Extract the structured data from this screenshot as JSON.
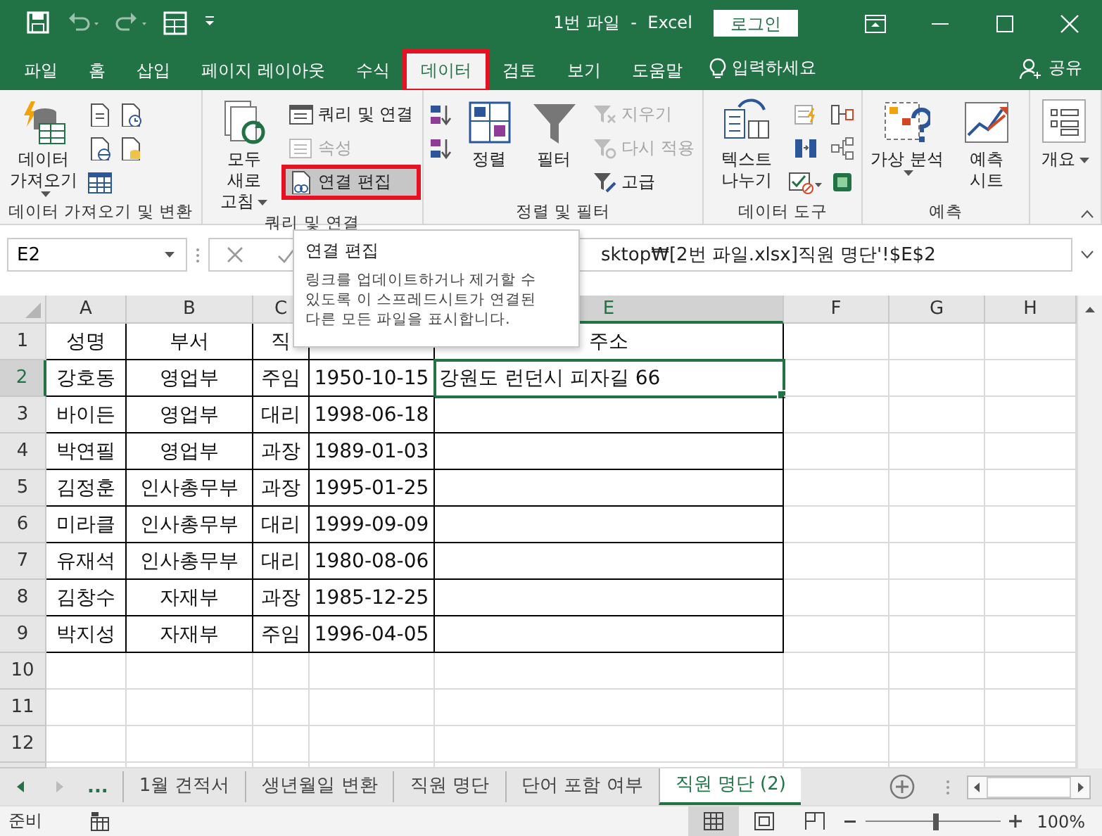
{
  "title_bar": {
    "title": "1번 파일  -  Excel",
    "login_button": "로그인",
    "quick_access": [
      {
        "kind": "save",
        "disabled": false
      },
      {
        "kind": "undo",
        "disabled": true
      },
      {
        "kind": "redo",
        "disabled": true
      },
      {
        "kind": "form",
        "disabled": false
      },
      {
        "kind": "customize",
        "disabled": false
      }
    ]
  },
  "tabs": [
    {
      "label": "파일",
      "selected": false,
      "highlighted": false
    },
    {
      "label": "홈",
      "selected": false,
      "highlighted": false
    },
    {
      "label": "삽입",
      "selected": false,
      "highlighted": false
    },
    {
      "label": "페이지 레이아웃",
      "selected": false,
      "highlighted": false
    },
    {
      "label": "수식",
      "selected": false,
      "highlighted": false
    },
    {
      "label": "데이터",
      "selected": true,
      "highlighted": true
    },
    {
      "label": "검토",
      "selected": false,
      "highlighted": false
    },
    {
      "label": "보기",
      "selected": false,
      "highlighted": false
    },
    {
      "label": "도움말",
      "selected": false,
      "highlighted": false
    }
  ],
  "tell_me": "입력하세요",
  "share": "공유",
  "ribbon": {
    "groups": [
      {
        "label": "데이터 가져오기 및 변환",
        "items": [
          {
            "kind": "large",
            "label": "데이터 가져오기",
            "dropdown": true
          },
          {
            "kind": "icon"
          },
          {
            "kind": "icon"
          },
          {
            "kind": "icon"
          },
          {
            "kind": "icon"
          },
          {
            "kind": "icon"
          }
        ]
      },
      {
        "label": "쿼리 및 연결",
        "items": [
          {
            "kind": "large",
            "label": "모두 새로 고침",
            "dropdown": true
          },
          {
            "kind": "small",
            "label": "쿼리 및 연결",
            "disabled": false,
            "highlighted": false
          },
          {
            "kind": "small",
            "label": "속성",
            "disabled": true,
            "highlighted": false
          },
          {
            "kind": "small",
            "label": "연결 편집",
            "disabled": false,
            "highlighted": true
          }
        ]
      },
      {
        "label": "정렬 및 필터",
        "items": [
          {
            "kind": "icon"
          },
          {
            "kind": "icon"
          },
          {
            "kind": "large",
            "label": "정렬",
            "dropdown": false
          },
          {
            "kind": "large",
            "label": "필터",
            "dropdown": false
          },
          {
            "kind": "small",
            "label": "지우기",
            "disabled": true,
            "highlighted": false
          },
          {
            "kind": "small",
            "label": "다시 적용",
            "disabled": true,
            "highlighted": false
          },
          {
            "kind": "small",
            "label": "고급",
            "disabled": false,
            "highlighted": false
          }
        ]
      },
      {
        "label": "데이터 도구",
        "items": [
          {
            "kind": "large",
            "label": "텍스트 나누기",
            "dropdown": false
          },
          {
            "kind": "icon"
          },
          {
            "kind": "icon"
          },
          {
            "kind": "icon"
          },
          {
            "kind": "icon"
          },
          {
            "kind": "icon"
          },
          {
            "kind": "icon"
          }
        ]
      },
      {
        "label": "예측",
        "items": [
          {
            "kind": "large",
            "label": "가상 분석",
            "dropdown": true
          },
          {
            "kind": "large",
            "label": "예측 시트",
            "dropdown": false
          }
        ]
      },
      {
        "items": [
          {
            "kind": "large",
            "label": "개요",
            "dropdown": true
          }
        ]
      }
    ]
  },
  "tooltip": {
    "title": "연결 편집",
    "text": "링크를 업데이트하거나 제거할 수 있도록 이 스프레드시트가 연결된 다른 모든 파일을 표시합니다."
  },
  "formula_bar": {
    "name_box": "E2",
    "formula": "sktop₩[2번 파일.xlsx]직원 명단'!$E$2"
  },
  "grid": {
    "columns": [
      {
        "label": "A",
        "selected": false
      },
      {
        "label": "B",
        "selected": false
      },
      {
        "label": "C",
        "selected": false
      },
      {
        "selected": false
      },
      {
        "label": "E",
        "selected": true
      },
      {
        "label": "F",
        "selected": false
      },
      {
        "label": "G",
        "selected": false
      },
      {
        "label": "H",
        "selected": false
      }
    ],
    "rows": [
      {
        "number": "1",
        "selected": false,
        "bordered": true,
        "cells": [
          {
            "text": "성명"
          },
          {
            "text": "부서"
          },
          {
            "text": "직"
          },
          {},
          {
            "text": "주소"
          }
        ]
      },
      {
        "number": "2",
        "selected": true,
        "bordered": true,
        "cells": [
          {
            "text": "강호동"
          },
          {
            "text": "영업부"
          },
          {
            "text": "주임"
          },
          {
            "text": "1950-10-15"
          },
          {
            "text": "강원도 런던시 피자길 66"
          }
        ]
      },
      {
        "number": "3",
        "selected": false,
        "bordered": true,
        "cells": [
          {
            "text": "바이든"
          },
          {
            "text": "영업부"
          },
          {
            "text": "대리"
          },
          {
            "text": "1998-06-18"
          }
        ]
      },
      {
        "number": "4",
        "selected": false,
        "bordered": true,
        "cells": [
          {
            "text": "박연필"
          },
          {
            "text": "영업부"
          },
          {
            "text": "과장"
          },
          {
            "text": "1989-01-03"
          }
        ]
      },
      {
        "number": "5",
        "selected": false,
        "bordered": true,
        "cells": [
          {
            "text": "김정훈"
          },
          {
            "text": "인사총무부"
          },
          {
            "text": "과장"
          },
          {
            "text": "1995-01-25"
          }
        ]
      },
      {
        "number": "6",
        "selected": false,
        "bordered": true,
        "cells": [
          {
            "text": "미라클"
          },
          {
            "text": "인사총무부"
          },
          {
            "text": "대리"
          },
          {
            "text": "1999-09-09"
          }
        ]
      },
      {
        "number": "7",
        "selected": false,
        "bordered": true,
        "cells": [
          {
            "text": "유재석"
          },
          {
            "text": "인사총무부"
          },
          {
            "text": "대리"
          },
          {
            "text": "1980-08-06"
          }
        ]
      },
      {
        "number": "8",
        "selected": false,
        "bordered": true,
        "cells": [
          {
            "text": "김창수"
          },
          {
            "text": "자재부"
          },
          {
            "text": "과장"
          },
          {
            "text": "1985-12-25"
          }
        ]
      },
      {
        "number": "9",
        "selected": false,
        "bordered": true,
        "cells": [
          {
            "text": "박지성"
          },
          {
            "text": "자재부"
          },
          {
            "text": "주임"
          },
          {
            "text": "1996-04-05"
          }
        ]
      },
      {
        "number": "10",
        "selected": false,
        "bordered": false,
        "cells": []
      },
      {
        "number": "11",
        "selected": false,
        "bordered": false,
        "cells": []
      },
      {
        "number": "12",
        "selected": false,
        "bordered": false,
        "cells": []
      }
    ]
  },
  "sheet_tabs": {
    "more": "...",
    "tabs": [
      {
        "label": "1월 견적서",
        "selected": false
      },
      {
        "label": "생년월일 변환",
        "selected": false
      },
      {
        "label": "직원 명단",
        "selected": false
      },
      {
        "label": "단어 포함 여부",
        "selected": false
      },
      {
        "label": "직원 명단 (2)",
        "selected": true
      }
    ]
  },
  "status_bar": {
    "status": "준비",
    "views": [
      {
        "kind": "normal",
        "selected": true
      },
      {
        "kind": "page-layout",
        "selected": false
      },
      {
        "kind": "page-break",
        "selected": false
      }
    ],
    "zoom": {
      "level": 0.52,
      "reading": "100%"
    }
  }
}
